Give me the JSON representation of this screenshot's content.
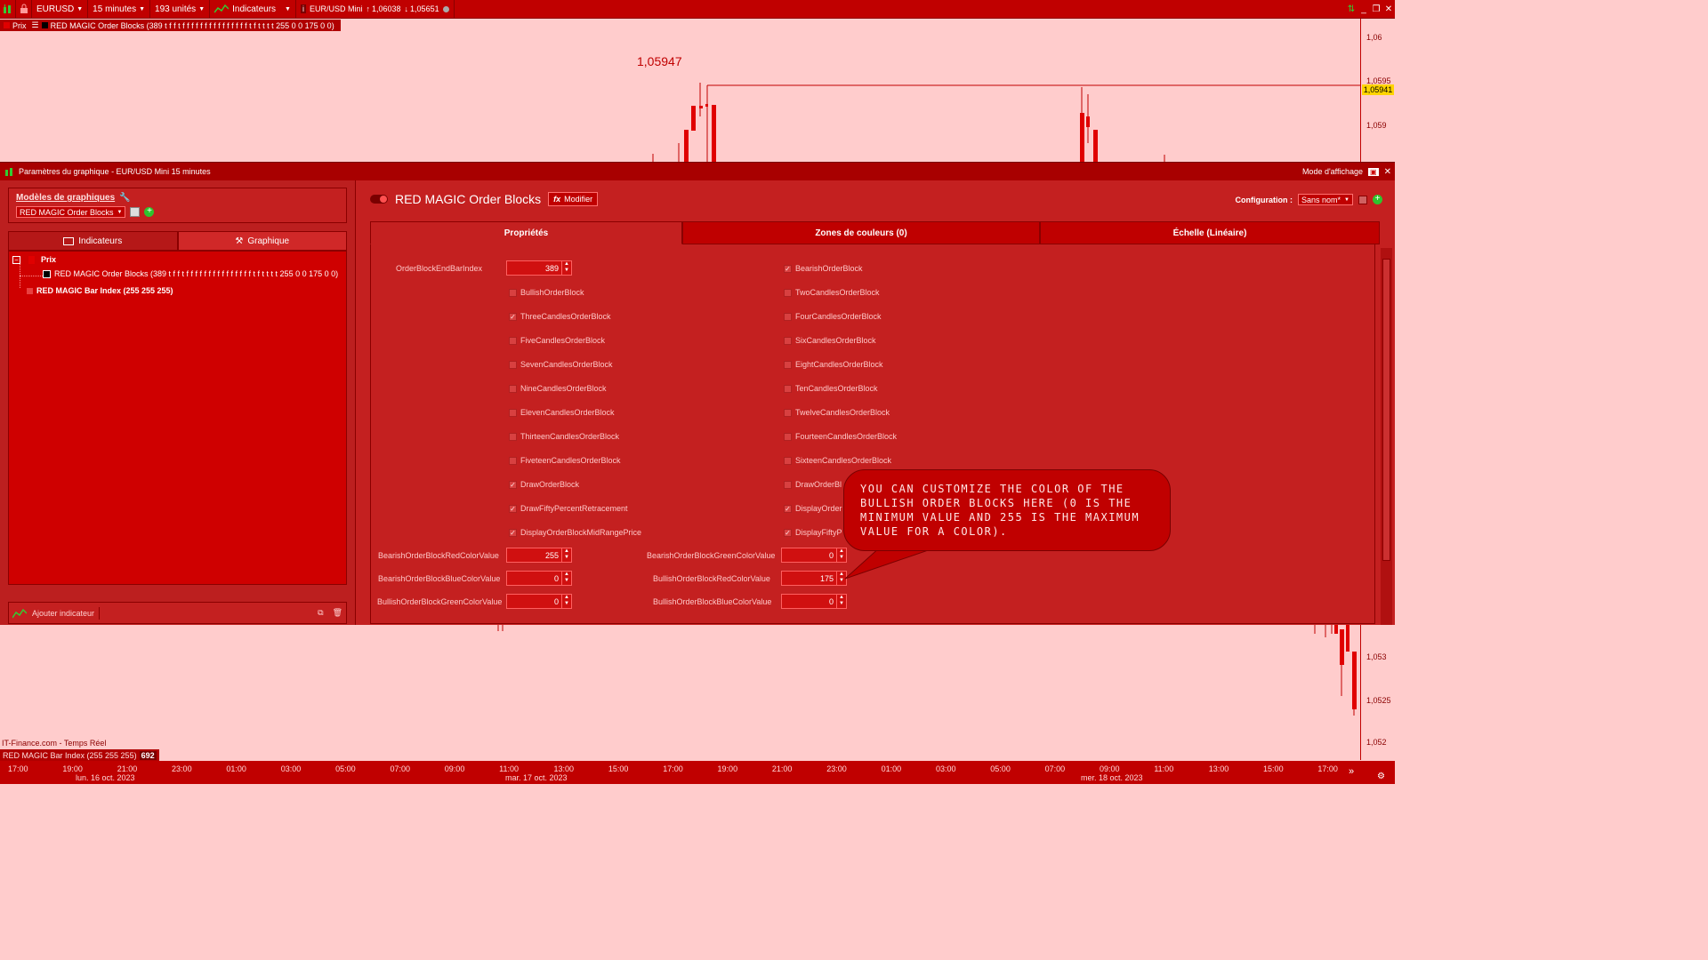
{
  "toolbar": {
    "symbol": "EURUSD",
    "timeframe": "15 minutes",
    "units": "193 unités",
    "indicators": "Indicateurs",
    "instrument": "EUR/USD Mini",
    "high": "1,06038",
    "low": "1,05651"
  },
  "legend": {
    "prix": "Prix",
    "indicator": "RED MAGIC Order Blocks (389 t f f t f f f f f f f f f f f f f f f t f t t t t 255 0 0 175 0 0)"
  },
  "chart_top": {
    "price_label": "1,05947",
    "axis_ticks": [
      "1,06",
      "1,0595",
      "1,059"
    ],
    "current_price": "1,05941"
  },
  "dialog": {
    "title": "Paramètres du graphique - EUR/USD Mini 15 minutes",
    "mode": "Mode d'affichage",
    "models_link": "Modèles de graphiques",
    "models_select": "RED MAGIC Order Blocks",
    "tab_indicators": "Indicateurs",
    "tab_chart": "Graphique",
    "tree": {
      "prix": "Prix",
      "child": "RED MAGIC Order Blocks (389 t f f t f f f f f f f f f f f f f f f t f t t t t 255 0 0 175 0 0)",
      "bar_index": "RED MAGIC Bar Index (255 255 255)"
    },
    "add_indicator": "Ajouter indicateur",
    "indicator_name": "RED MAGIC Order Blocks",
    "modify": "Modifier",
    "config_label": "Configuration :",
    "config_value": "Sans nom*",
    "tabs": [
      "Propriétés",
      "Zones de couleurs (0)",
      "Échelle (Linéaire)"
    ]
  },
  "props": {
    "end_bar_label": "OrderBlockEndBarIndex",
    "end_bar_value": "389",
    "left_checks": [
      {
        "label": "BullishOrderBlock",
        "checked": false
      },
      {
        "label": "ThreeCandlesOrderBlock",
        "checked": true
      },
      {
        "label": "FiveCandlesOrderBlock",
        "checked": false
      },
      {
        "label": "SevenCandlesOrderBlock",
        "checked": false
      },
      {
        "label": "NineCandlesOrderBlock",
        "checked": false
      },
      {
        "label": "ElevenCandlesOrderBlock",
        "checked": false
      },
      {
        "label": "ThirteenCandlesOrderBlock",
        "checked": false
      },
      {
        "label": "FiveteenCandlesOrderBlock",
        "checked": false
      },
      {
        "label": "DrawOrderBlock",
        "checked": true
      },
      {
        "label": "DrawFiftyPercentRetracement",
        "checked": true
      },
      {
        "label": "DisplayOrderBlockMidRangePrice",
        "checked": true
      }
    ],
    "right_checks": [
      {
        "label": "BearishOrderBlock",
        "checked": true
      },
      {
        "label": "TwoCandlesOrderBlock",
        "checked": false
      },
      {
        "label": "FourCandlesOrderBlock",
        "checked": false
      },
      {
        "label": "SixCandlesOrderBlock",
        "checked": false
      },
      {
        "label": "EightCandlesOrderBlock",
        "checked": false
      },
      {
        "label": "TenCandlesOrderBlock",
        "checked": false
      },
      {
        "label": "TwelveCandlesOrderBlock",
        "checked": false
      },
      {
        "label": "FourteenCandlesOrderBlock",
        "checked": false
      },
      {
        "label": "SixteenCandlesOrderBlock",
        "checked": false
      },
      {
        "label": "DrawOrderBl",
        "checked": false
      },
      {
        "label": "DisplayOrder",
        "checked": true
      },
      {
        "label": "DisplayFiftyP",
        "checked": true
      }
    ],
    "fields": [
      {
        "label": "BearishOrderBlockRedColorValue",
        "value": "255"
      },
      {
        "label": "BearishOrderBlockGreenColorValue",
        "value": "0"
      },
      {
        "label": "BearishOrderBlockBlueColorValue",
        "value": "0"
      },
      {
        "label": "BullishOrderBlockRedColorValue",
        "value": "175"
      },
      {
        "label": "BullishOrderBlockGreenColorValue",
        "value": "0"
      },
      {
        "label": "BullishOrderBlockBlueColorValue",
        "value": "0"
      }
    ]
  },
  "bubble": {
    "text": "You can customize the color of the bullish order blocks here (0 is the minimum value and 255 is the maximum value for a color)."
  },
  "chart_bottom": {
    "axis_ticks": [
      "1,053",
      "1,0525",
      "1,052"
    ],
    "source": "IT-Finance.com - Temps Réel",
    "legend": "RED MAGIC Bar Index (255 255 255)",
    "legend_value": "692"
  },
  "time_axis": {
    "times": [
      "17:00",
      "19:00",
      "21:00",
      "23:00",
      "01:00",
      "03:00",
      "05:00",
      "07:00",
      "09:00",
      "11:00",
      "13:00",
      "15:00",
      "17:00",
      "19:00",
      "21:00",
      "23:00",
      "01:00",
      "03:00",
      "05:00",
      "07:00",
      "09:00",
      "11:00",
      "13:00",
      "15:00",
      "17:00"
    ],
    "dates": [
      "lun. 16 oct. 2023",
      "mar. 17 oct. 2023",
      "mer. 18 oct. 2023"
    ]
  },
  "colors": {
    "accent": "#c00000",
    "panel": "#c42020",
    "background": "#ffcccc",
    "price_tag": "#ffd400"
  }
}
